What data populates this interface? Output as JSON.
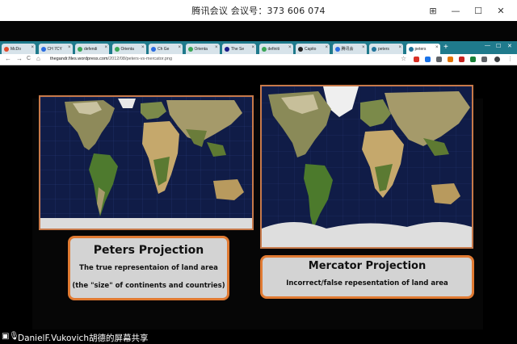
{
  "meeting": {
    "title": "腾讯会议 会议号：373 606 074",
    "controls": {
      "pin": "⊞",
      "minimize": "—",
      "maximize": "☐",
      "close": "✕"
    }
  },
  "browser": {
    "tabs": [
      {
        "label": "McDo",
        "icon_color": "#e24a2b"
      },
      {
        "label": "CH 7CY",
        "icon_color": "#2b6de2"
      },
      {
        "label": "defendi",
        "icon_color": "#3aa756"
      },
      {
        "label": "Orienta",
        "icon_color": "#3aa756"
      },
      {
        "label": "Ch Ge",
        "icon_color": "#2b6de2"
      },
      {
        "label": "Orienta",
        "icon_color": "#3aa756"
      },
      {
        "label": "The Se",
        "icon_color": "#1a1a8a"
      },
      {
        "label": "definiti",
        "icon_color": "#3aa756"
      },
      {
        "label": "Capito",
        "icon_color": "#222222"
      },
      {
        "label": "腾讯会",
        "icon_color": "#2b6de2"
      },
      {
        "label": "peters",
        "icon_color": "#21759b"
      },
      {
        "label": "peters",
        "icon_color": "#21759b"
      }
    ],
    "new_tab_label": "+",
    "url_host": "thegandr.files.wordpress.com",
    "url_path": "/2012/08/peters-vs-mercator.png",
    "nav": {
      "back": "←",
      "forward": "→",
      "reload": "C",
      "home": "⌂",
      "lock": "🔒",
      "star": "☆"
    }
  },
  "slide": {
    "left_caption": {
      "title": "Peters Projection",
      "line1": "The true representaion of land area",
      "line2": "(the \"size\" of continents and countries)"
    },
    "right_caption": {
      "title": "Mercator Projection",
      "line1": "Incorrect/false repesentation of land area"
    }
  },
  "share": {
    "label": "DanielF.Vukovich胡德的屏幕共享"
  },
  "colors": {
    "tabstrip": "#1f7a8c",
    "caption_border": "#e07a32",
    "map_border": "#c7794a",
    "ocean": "#0f1b45"
  }
}
